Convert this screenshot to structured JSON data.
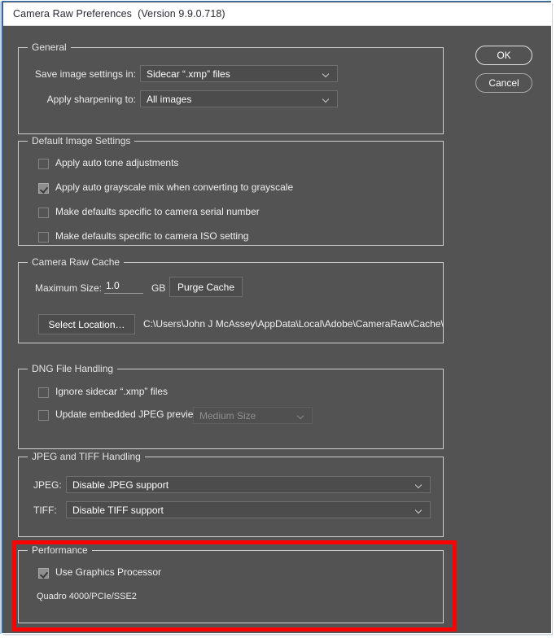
{
  "window": {
    "title": "Camera Raw Preferences",
    "version": "(Version 9.9.0.718)",
    "accent_border": "#2d7bd1",
    "body_bg": "#535353"
  },
  "buttons": {
    "ok": "OK",
    "cancel": "Cancel"
  },
  "groups": {
    "general": {
      "legend": "General",
      "save_label": "Save image settings in:",
      "save_value": "Sidecar “.xmp” files",
      "sharpen_label": "Apply sharpening to:",
      "sharpen_value": "All images"
    },
    "default_image_settings": {
      "legend": "Default Image Settings",
      "checkboxes": [
        {
          "label": "Apply auto tone adjustments",
          "checked": false
        },
        {
          "label": "Apply auto grayscale mix when converting to grayscale",
          "checked": true
        },
        {
          "label": "Make defaults specific to camera serial number",
          "checked": false
        },
        {
          "label": "Make defaults specific to camera ISO setting",
          "checked": false
        }
      ]
    },
    "camera_raw_cache": {
      "legend": "Camera Raw Cache",
      "max_size_label": "Maximum Size:",
      "max_size_value": "1.0",
      "units": "GB",
      "purge_button": "Purge Cache",
      "select_location_button": "Select Location…",
      "cache_path": "C:\\Users\\John J McAssey\\AppData\\Local\\Adobe\\CameraRaw\\Cache\\"
    },
    "dng_file_handling": {
      "legend": "DNG File Handling",
      "ignore_sidecar": {
        "label": "Ignore sidecar “.xmp” files",
        "checked": false
      },
      "update_previews": {
        "label": "Update embedded JPEG previews:",
        "checked": false
      },
      "preview_size_value": "Medium Size",
      "preview_size_disabled": true
    },
    "jpeg_tiff_handling": {
      "legend": "JPEG and TIFF Handling",
      "jpeg_label": "JPEG:",
      "jpeg_value": "Disable JPEG support",
      "tiff_label": "TIFF:",
      "tiff_value": "Disable TIFF support"
    },
    "performance": {
      "legend": "Performance",
      "use_gpu": {
        "label": "Use Graphics Processor",
        "checked": true
      },
      "gpu_name": "Quadro 4000/PCIe/SSE2",
      "highlight_color": "#fe0000"
    }
  },
  "icons": {
    "chevron": "chevron-down-icon",
    "check": "checkmark-icon"
  }
}
